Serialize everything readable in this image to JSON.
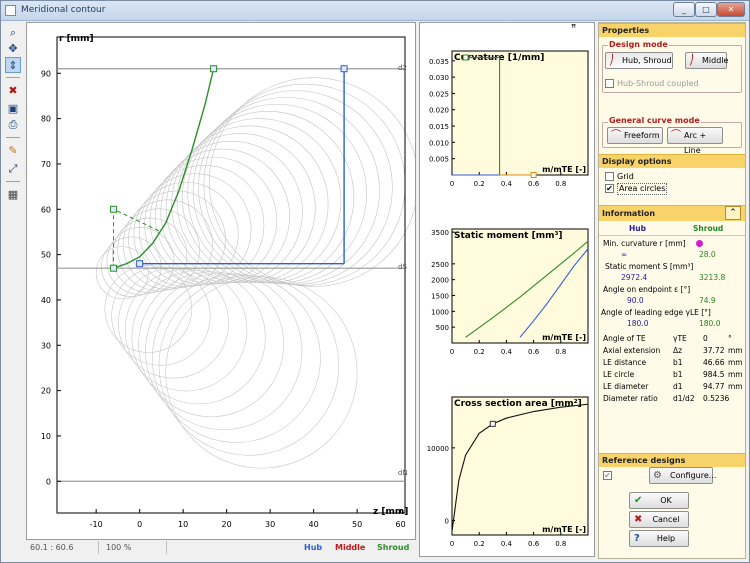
{
  "window": {
    "title": "Meridional contour",
    "btn_min": "_",
    "btn_max": "□",
    "btn_close": "✕"
  },
  "toolbar": {
    "icons": [
      "zoom-icon",
      "pan-icon",
      "fit-icon",
      "clear-icon",
      "save-icon",
      "print-icon",
      "copy-icon",
      "export-icon",
      "resize-icon",
      "settings-icon"
    ]
  },
  "main_plot": {
    "ylabel": "r [mm]",
    "xlabel": "z [mm]",
    "x_ticks": [
      "-10",
      "0",
      "10",
      "20",
      "30",
      "40",
      "50",
      "60"
    ],
    "y_ticks": [
      "0",
      "10",
      "20",
      "30",
      "40",
      "50",
      "60",
      "70",
      "80",
      "90"
    ],
    "line_labels": {
      "d2": "d2",
      "dS": "dS",
      "dN": "dN"
    }
  },
  "chart_data": [
    {
      "type": "line",
      "chart": "meridional-contour",
      "xlabel": "z [mm]",
      "ylabel": "r [mm]",
      "xlim": [
        -19,
        61
      ],
      "ylim": [
        -7,
        98
      ],
      "series": [
        {
          "name": "Shroud",
          "color": "#2a8f2a",
          "x": [
            -6,
            -3,
            0,
            3,
            6,
            9,
            12,
            15,
            17
          ],
          "y": [
            47,
            48,
            49.5,
            52.5,
            57,
            64,
            73,
            83,
            91
          ]
        },
        {
          "name": "Hub",
          "color": "#2d5fd6",
          "x": [
            0,
            47
          ],
          "y": [
            48,
            48
          ]
        },
        {
          "name": "Hub TE",
          "color": "#2d5fd6",
          "x": [
            47,
            47
          ],
          "y": [
            48,
            91
          ]
        }
      ],
      "reference_lines": {
        "d2": 91,
        "dS": 47,
        "dN": 0
      }
    },
    {
      "type": "line",
      "chart": "curvature",
      "title": "Curvature [1/mm]",
      "xlabel": "m/mTE [-]",
      "x_ticks": [
        "0",
        "0.2",
        "0.4",
        "0.6",
        "0.8"
      ],
      "y_ticks": [
        "0.005",
        "0.010",
        "0.015",
        "0.020",
        "0.025",
        "0.030",
        "0.035"
      ],
      "xlim": [
        0,
        1
      ],
      "ylim": [
        0,
        0.038
      ],
      "series": [
        {
          "name": "Shroud",
          "color": "#2a8f2a",
          "x": [
            0.1,
            0.35,
            0.35
          ],
          "y": [
            0.036,
            0.036,
            0.0
          ]
        },
        {
          "name": "Hub",
          "color": "#2d5fd6",
          "x": [
            0.0,
            0.35
          ],
          "y": [
            0.0,
            0.0
          ]
        },
        {
          "name": "Middle",
          "color": "#e08a10",
          "x": [
            0.35,
            0.6
          ],
          "y": [
            0.0,
            0.0
          ]
        }
      ]
    },
    {
      "type": "line",
      "chart": "static-moment",
      "title": "Static moment [mm³]",
      "xlabel": "m/mTE [-]",
      "x_ticks": [
        "0",
        "0.2",
        "0.4",
        "0.6",
        "0.8"
      ],
      "y_ticks": [
        "500",
        "1000",
        "1500",
        "2000",
        "2500",
        "3500"
      ],
      "xlim": [
        0,
        1
      ],
      "ylim": [
        0,
        3600
      ],
      "series": [
        {
          "name": "Shroud",
          "color": "#2a8f2a",
          "x": [
            0.1,
            0.3,
            0.5,
            0.7,
            0.9,
            1.0
          ],
          "y": [
            180,
            800,
            1450,
            2150,
            2850,
            3214
          ]
        },
        {
          "name": "Hub",
          "color": "#2d5fd6",
          "x": [
            0.5,
            0.6,
            0.7,
            0.8,
            0.9,
            1.0
          ],
          "y": [
            180,
            700,
            1250,
            1850,
            2450,
            2972
          ]
        }
      ]
    },
    {
      "type": "line",
      "chart": "cross-section-area",
      "title": "Cross section area [mm²]",
      "xlabel": "m/mTE [-]",
      "x_ticks": [
        "0",
        "0.2",
        "0.4",
        "0.6",
        "0.8"
      ],
      "y_ticks": [
        "0",
        "10000"
      ],
      "xlim": [
        0,
        1
      ],
      "ylim": [
        -2000,
        17000
      ],
      "series": [
        {
          "name": "Area",
          "color": "#111111",
          "x": [
            0,
            0.05,
            0.1,
            0.2,
            0.3,
            0.4,
            0.6,
            0.8,
            1.0
          ],
          "y": [
            -1500,
            5500,
            9000,
            12000,
            13300,
            14100,
            15000,
            15600,
            16000
          ]
        }
      ]
    }
  ],
  "status": {
    "coords": "60.1 : 60.6",
    "zoom": "100 %",
    "legend_hub": "Hub",
    "legend_middle": "Middle",
    "legend_shroud": "Shroud"
  },
  "properties": {
    "header": "Properties",
    "design_mode": {
      "title": "Design mode",
      "btn_hub_shroud": "Hub, Shroud",
      "btn_middle": "Middle",
      "chk_coupled": "Hub-Shroud coupled"
    },
    "general_curve": {
      "title": "General curve mode",
      "btn_freeform": "Freeform",
      "btn_arc_line": "Arc + Line"
    }
  },
  "display_options": {
    "header": "Display options",
    "grid": "Grid",
    "area_circles": "Area circles"
  },
  "information": {
    "header": "Information",
    "col_hub": "Hub",
    "col_shroud": "Shroud",
    "min_curv_label": "Min. curvature r [mm]",
    "min_curv_hub": "∞",
    "min_curv_shroud": "28.0",
    "static_label": "Static moment S [mm³]",
    "static_hub": "2972.4",
    "static_shroud": "3213.8",
    "angle_end_label": "Angle on endpoint ε [°]",
    "angle_end_hub": "90.0",
    "angle_end_shroud": "74.9",
    "angle_le_label": "Angle of leading edge γLE [°]",
    "angle_le_hub": "180.0",
    "angle_le_shroud": "180.0",
    "rows": [
      {
        "label": "Angle of TE",
        "sym": "γTE",
        "value": "0",
        "unit": "°"
      },
      {
        "label": "Axial extension",
        "sym": "Δz",
        "value": "37.72",
        "unit": "mm"
      },
      {
        "label": "LE distance",
        "sym": "b1",
        "value": "46.66",
        "unit": "mm"
      },
      {
        "label": "LE circle",
        "sym": "b1",
        "value": "984.5",
        "unit": "mm"
      },
      {
        "label": "LE diameter",
        "sym": "d1",
        "value": "94.77",
        "unit": "mm"
      },
      {
        "label": "Diameter ratio",
        "sym": "d1/d2",
        "value": "0.5236",
        "unit": ""
      }
    ],
    "collapse_glyph": "⌃"
  },
  "reference_designs": {
    "header": "Reference designs",
    "btn_configure": "Configure..."
  },
  "dialog": {
    "ok": "OK",
    "cancel": "Cancel",
    "help": "Help"
  },
  "pin_glyph": "ꟸ",
  "colors": {
    "hub": "#2d5fd6",
    "middle": "#c21818",
    "shroud": "#2a8f2a",
    "chart_bg": "#fffbdc",
    "section_head": "#f7d36a"
  }
}
